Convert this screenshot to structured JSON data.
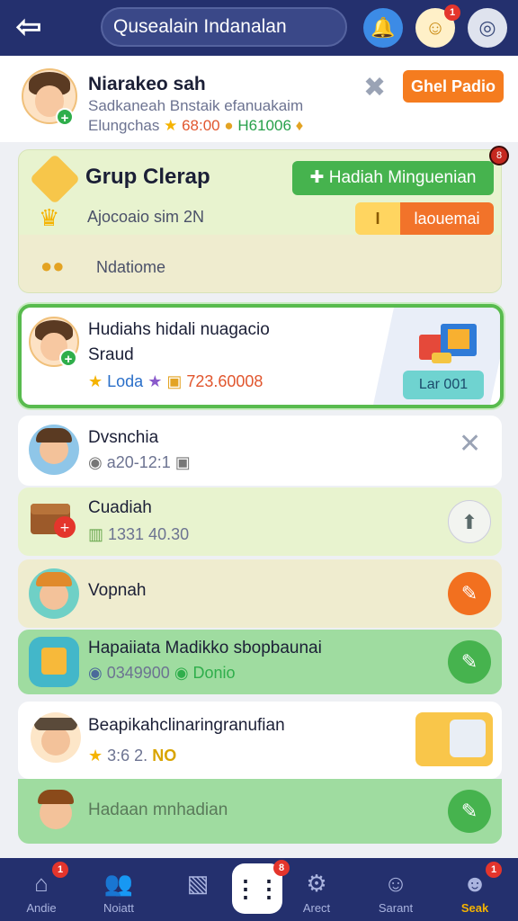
{
  "colors": {
    "topbar": "#24306e",
    "primary_green": "#46b34e",
    "accent_orange": "#f57c1f",
    "highlight_border": "#58bb4e"
  },
  "header": {
    "search_text": "Qusealain Indanalan",
    "icons": [
      "back-arrow-icon",
      "bell-icon",
      "user-icon",
      "target-icon"
    ],
    "user_badge": "1"
  },
  "profile": {
    "name": "Niarakeo sah",
    "subtitle": "Sadkaneah Bnstaik efanuakaim",
    "label": "Elungchas",
    "stat1": "68:00",
    "stat2": "H61006",
    "button": "Ghel Padio"
  },
  "group": {
    "title": "Grup Clerap",
    "main_button": "Hadiah Minguenian",
    "meta": "Ajocoaio sim 2N",
    "split_left": "I",
    "split_right": "laouemai",
    "coins_label": "Ndatiome",
    "corner_badge": "8"
  },
  "featured": {
    "title": "Hudiahs hidali nuagacio",
    "subtitle": "Sraud",
    "stat_label": "Loda",
    "stat_value": "723.60008",
    "button": "Lar 001"
  },
  "list": [
    {
      "title": "Dvsnchia",
      "meta": "a20-12:1"
    },
    {
      "title": "Cuadiah",
      "meta": "1331 40.30"
    },
    {
      "title": "Vopnah"
    },
    {
      "title": "Hapaiiata Madikko sbopbaunai",
      "meta": "0349900",
      "meta_green": "Donio"
    },
    {
      "title": "Beapikahclinaringranufian",
      "meta": "3:6 2.",
      "meta_badge": "NO"
    },
    {
      "title": "Hadaan mnhadian"
    }
  ],
  "bottom_nav": [
    {
      "label": "Andie",
      "icon": "home-icon",
      "badge": "1"
    },
    {
      "label": "Noiatt",
      "icon": "people-icon"
    },
    {
      "label": "",
      "icon": "chart-icon"
    },
    {
      "label": "",
      "icon": "grid-icon",
      "badge": "8"
    },
    {
      "label": "Arect",
      "icon": "gear-icon"
    },
    {
      "label": "Sarant",
      "icon": "smile-icon"
    },
    {
      "label": "Seak",
      "icon": "avatar-icon",
      "badge": "1"
    }
  ]
}
